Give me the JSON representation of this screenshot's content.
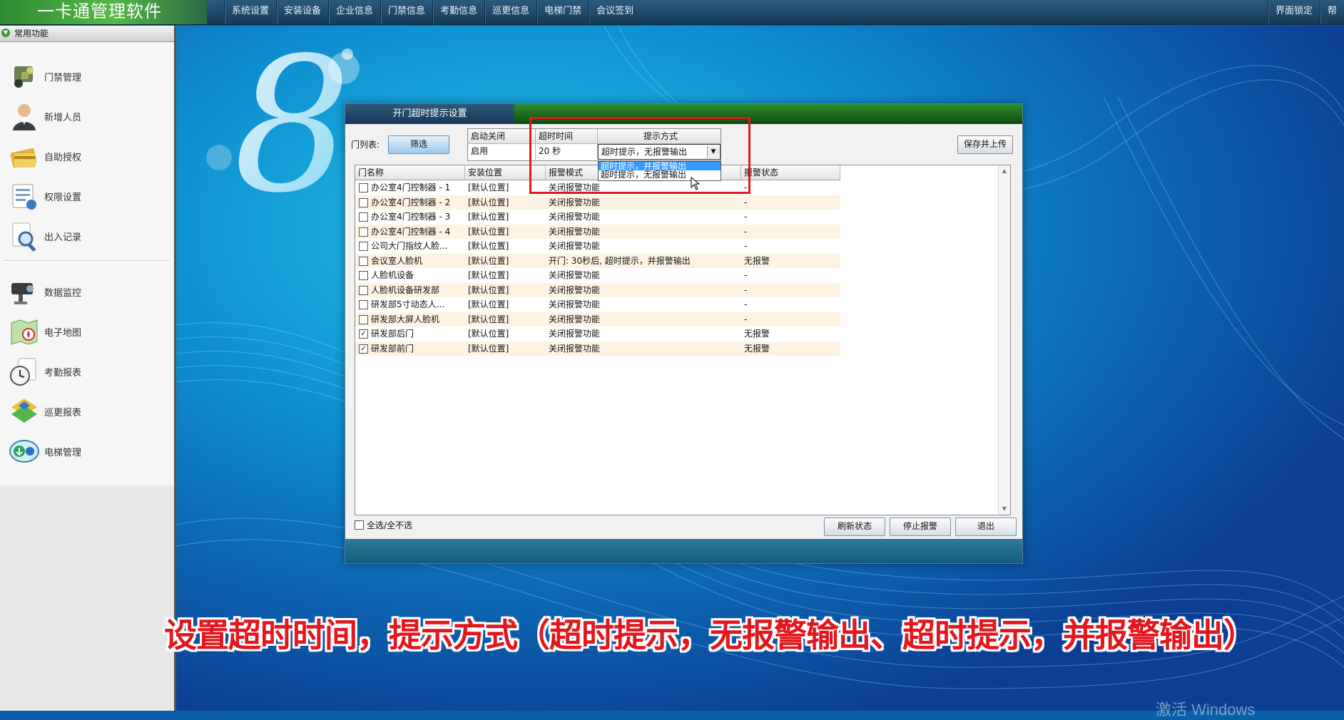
{
  "app": {
    "title": "一卡通管理软件"
  },
  "menu": {
    "items": [
      "系统设置",
      "安装设备",
      "企业信息",
      "门禁信息",
      "考勤信息",
      "巡更信息",
      "电梯门禁",
      "会议签到"
    ],
    "right": [
      "界面锁定",
      "帮"
    ]
  },
  "sidebar": {
    "header": "常用功能",
    "group1": [
      {
        "label": "门禁管理",
        "icon": "door-control-icon"
      },
      {
        "label": "新增人员",
        "icon": "person-icon"
      },
      {
        "label": "自助授权",
        "icon": "card-icon"
      },
      {
        "label": "权限设置",
        "icon": "permission-icon"
      },
      {
        "label": "出入记录",
        "icon": "record-search-icon"
      }
    ],
    "group2": [
      {
        "label": "数据监控",
        "icon": "monitor-camera-icon"
      },
      {
        "label": "电子地图",
        "icon": "map-icon"
      },
      {
        "label": "考勤报表",
        "icon": "clock-report-icon"
      },
      {
        "label": "巡更报表",
        "icon": "patrol-icon"
      },
      {
        "label": "电梯管理",
        "icon": "elevator-icon"
      }
    ]
  },
  "dialog": {
    "tab_title": "开门超时提示设置",
    "door_list_label": "门列表:",
    "filter_button": "筛选",
    "save_button": "保存并上传",
    "settings": {
      "col_enable": "启动关闭",
      "col_timeout": "超时时间",
      "col_mode": "提示方式",
      "enable_value": "启用",
      "timeout_value": "20 秒",
      "mode_value": "超时提示，无报警输出"
    },
    "dropdown_options": [
      "超时提示，并报警输出",
      "超时提示，无报警输出"
    ],
    "table": {
      "headers": [
        "门名称",
        "安装位置",
        "报警模式",
        "报警状态"
      ],
      "rows": [
        {
          "checked": false,
          "name": "办公室4门控制器 - 1",
          "location": "[默认位置]",
          "mode": "关闭报警功能",
          "status": "-"
        },
        {
          "checked": false,
          "name": "办公室4门控制器 - 2",
          "location": "[默认位置]",
          "mode": "关闭报警功能",
          "status": "-"
        },
        {
          "checked": false,
          "name": "办公室4门控制器 - 3",
          "location": "[默认位置]",
          "mode": "关闭报警功能",
          "status": "-"
        },
        {
          "checked": false,
          "name": "办公室4门控制器 - 4",
          "location": "[默认位置]",
          "mode": "关闭报警功能",
          "status": "-"
        },
        {
          "checked": false,
          "name": "公司大门指纹人脸...",
          "location": "[默认位置]",
          "mode": "关闭报警功能",
          "status": "-"
        },
        {
          "checked": false,
          "name": "会议室人脸机",
          "location": "[默认位置]",
          "mode": "开门: 30秒后,  超时提示，并报警输出",
          "status": "无报警"
        },
        {
          "checked": false,
          "name": "人脸机设备",
          "location": "[默认位置]",
          "mode": "关闭报警功能",
          "status": "-"
        },
        {
          "checked": false,
          "name": "人脸机设备研发部",
          "location": "[默认位置]",
          "mode": "关闭报警功能",
          "status": "-"
        },
        {
          "checked": false,
          "name": "研发部5寸动态人...",
          "location": "[默认位置]",
          "mode": "关闭报警功能",
          "status": "-"
        },
        {
          "checked": false,
          "name": "研发部大屏人脸机",
          "location": "[默认位置]",
          "mode": "关闭报警功能",
          "status": "-"
        },
        {
          "checked": true,
          "name": "研发部后门",
          "location": "[默认位置]",
          "mode": "关闭报警功能",
          "status": "无报警"
        },
        {
          "checked": true,
          "name": "研发部前门",
          "location": "[默认位置]",
          "mode": "关闭报警功能",
          "status": "无报警"
        }
      ]
    },
    "select_all_label": "全选/全不选",
    "refresh_button": "刷新状态",
    "stop_alarm_button": "停止报警",
    "exit_button": "退出"
  },
  "caption": "设置超时时间，提示方式（超时提示，无报警输出、超时提示，并报警输出）",
  "watermark": "激活 Windows",
  "colors": {
    "caption_red": "#e3161d",
    "highlight_box": "#e0191f",
    "row_alt": "#fdf3e3"
  }
}
